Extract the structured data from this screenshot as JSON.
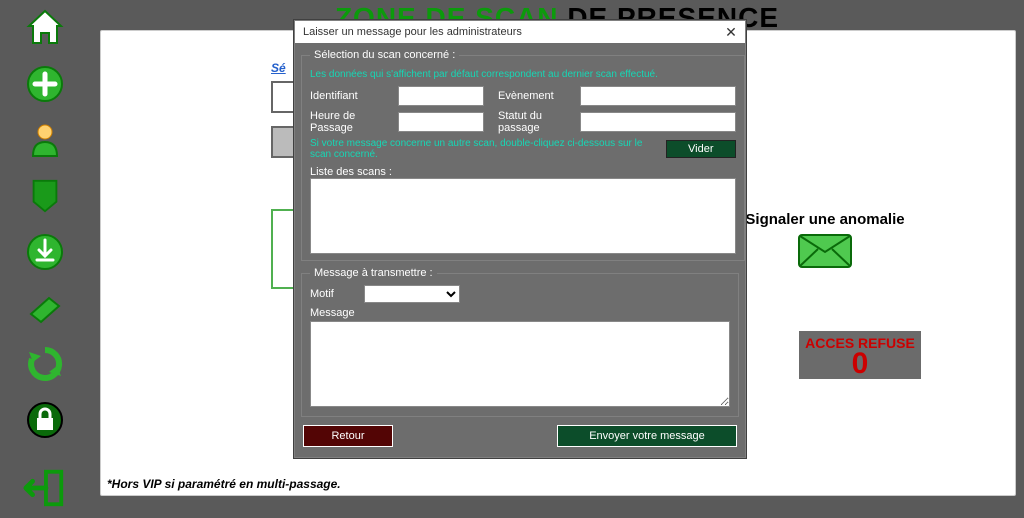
{
  "header": {
    "green": "ZONE DE SCAN",
    "black": "DE PRESENCE"
  },
  "sidebar": {
    "icons": [
      "home",
      "plus",
      "user",
      "flag",
      "download",
      "book",
      "refresh",
      "lock",
      "exit"
    ]
  },
  "panel": {
    "seg": "Sé",
    "anomaly_label": "Signaler une anomalie",
    "refuse_label": "ACCES REFUSE",
    "refuse_value": "0",
    "footnote": "*Hors VIP si paramétré en multi-passage."
  },
  "modal": {
    "title": "Laisser un message pour les administrateurs",
    "close": "✕",
    "section1_legend": "Sélection du scan concerné :",
    "hint1": "Les données qui s'affichent par défaut correspondent au dernier scan effectué.",
    "label_ident": "Identifiant",
    "label_event": "Evènement",
    "label_heure": "Heure de Passage",
    "label_statut": "Statut du passage",
    "ident_value": "",
    "event_value": "",
    "heure_value": "",
    "statut_value": "",
    "hint2": "Si votre message concerne un autre scan, double-cliquez ci-dessous sur le scan concerné.",
    "vider_label": "Vider",
    "liste_label": "Liste des scans :",
    "section2_legend": "Message à transmettre :",
    "label_motif": "Motif",
    "label_message": "Message",
    "btn_retour": "Retour",
    "btn_send": "Envoyer votre message"
  }
}
